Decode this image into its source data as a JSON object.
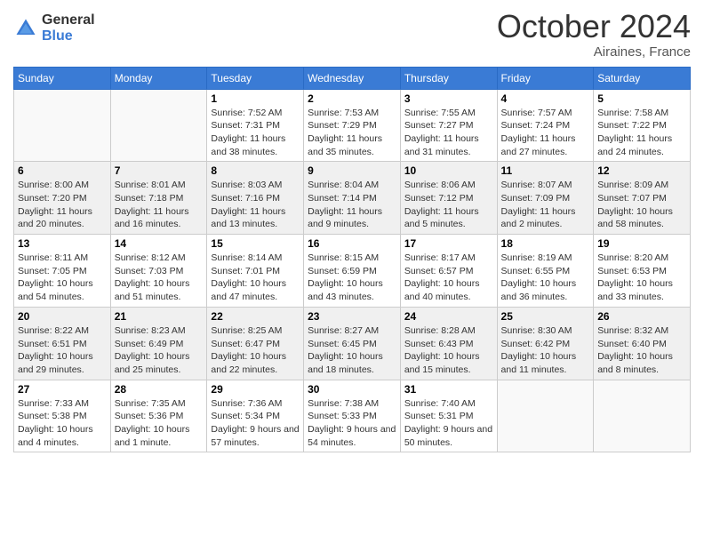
{
  "header": {
    "logo_general": "General",
    "logo_blue": "Blue",
    "month_title": "October 2024",
    "location": "Airaines, France"
  },
  "weekdays": [
    "Sunday",
    "Monday",
    "Tuesday",
    "Wednesday",
    "Thursday",
    "Friday",
    "Saturday"
  ],
  "weeks": [
    [
      {
        "day": "",
        "info": ""
      },
      {
        "day": "",
        "info": ""
      },
      {
        "day": "1",
        "sunrise": "Sunrise: 7:52 AM",
        "sunset": "Sunset: 7:31 PM",
        "daylight": "Daylight: 11 hours and 38 minutes."
      },
      {
        "day": "2",
        "sunrise": "Sunrise: 7:53 AM",
        "sunset": "Sunset: 7:29 PM",
        "daylight": "Daylight: 11 hours and 35 minutes."
      },
      {
        "day": "3",
        "sunrise": "Sunrise: 7:55 AM",
        "sunset": "Sunset: 7:27 PM",
        "daylight": "Daylight: 11 hours and 31 minutes."
      },
      {
        "day": "4",
        "sunrise": "Sunrise: 7:57 AM",
        "sunset": "Sunset: 7:24 PM",
        "daylight": "Daylight: 11 hours and 27 minutes."
      },
      {
        "day": "5",
        "sunrise": "Sunrise: 7:58 AM",
        "sunset": "Sunset: 7:22 PM",
        "daylight": "Daylight: 11 hours and 24 minutes."
      }
    ],
    [
      {
        "day": "6",
        "sunrise": "Sunrise: 8:00 AM",
        "sunset": "Sunset: 7:20 PM",
        "daylight": "Daylight: 11 hours and 20 minutes."
      },
      {
        "day": "7",
        "sunrise": "Sunrise: 8:01 AM",
        "sunset": "Sunset: 7:18 PM",
        "daylight": "Daylight: 11 hours and 16 minutes."
      },
      {
        "day": "8",
        "sunrise": "Sunrise: 8:03 AM",
        "sunset": "Sunset: 7:16 PM",
        "daylight": "Daylight: 11 hours and 13 minutes."
      },
      {
        "day": "9",
        "sunrise": "Sunrise: 8:04 AM",
        "sunset": "Sunset: 7:14 PM",
        "daylight": "Daylight: 11 hours and 9 minutes."
      },
      {
        "day": "10",
        "sunrise": "Sunrise: 8:06 AM",
        "sunset": "Sunset: 7:12 PM",
        "daylight": "Daylight: 11 hours and 5 minutes."
      },
      {
        "day": "11",
        "sunrise": "Sunrise: 8:07 AM",
        "sunset": "Sunset: 7:09 PM",
        "daylight": "Daylight: 11 hours and 2 minutes."
      },
      {
        "day": "12",
        "sunrise": "Sunrise: 8:09 AM",
        "sunset": "Sunset: 7:07 PM",
        "daylight": "Daylight: 10 hours and 58 minutes."
      }
    ],
    [
      {
        "day": "13",
        "sunrise": "Sunrise: 8:11 AM",
        "sunset": "Sunset: 7:05 PM",
        "daylight": "Daylight: 10 hours and 54 minutes."
      },
      {
        "day": "14",
        "sunrise": "Sunrise: 8:12 AM",
        "sunset": "Sunset: 7:03 PM",
        "daylight": "Daylight: 10 hours and 51 minutes."
      },
      {
        "day": "15",
        "sunrise": "Sunrise: 8:14 AM",
        "sunset": "Sunset: 7:01 PM",
        "daylight": "Daylight: 10 hours and 47 minutes."
      },
      {
        "day": "16",
        "sunrise": "Sunrise: 8:15 AM",
        "sunset": "Sunset: 6:59 PM",
        "daylight": "Daylight: 10 hours and 43 minutes."
      },
      {
        "day": "17",
        "sunrise": "Sunrise: 8:17 AM",
        "sunset": "Sunset: 6:57 PM",
        "daylight": "Daylight: 10 hours and 40 minutes."
      },
      {
        "day": "18",
        "sunrise": "Sunrise: 8:19 AM",
        "sunset": "Sunset: 6:55 PM",
        "daylight": "Daylight: 10 hours and 36 minutes."
      },
      {
        "day": "19",
        "sunrise": "Sunrise: 8:20 AM",
        "sunset": "Sunset: 6:53 PM",
        "daylight": "Daylight: 10 hours and 33 minutes."
      }
    ],
    [
      {
        "day": "20",
        "sunrise": "Sunrise: 8:22 AM",
        "sunset": "Sunset: 6:51 PM",
        "daylight": "Daylight: 10 hours and 29 minutes."
      },
      {
        "day": "21",
        "sunrise": "Sunrise: 8:23 AM",
        "sunset": "Sunset: 6:49 PM",
        "daylight": "Daylight: 10 hours and 25 minutes."
      },
      {
        "day": "22",
        "sunrise": "Sunrise: 8:25 AM",
        "sunset": "Sunset: 6:47 PM",
        "daylight": "Daylight: 10 hours and 22 minutes."
      },
      {
        "day": "23",
        "sunrise": "Sunrise: 8:27 AM",
        "sunset": "Sunset: 6:45 PM",
        "daylight": "Daylight: 10 hours and 18 minutes."
      },
      {
        "day": "24",
        "sunrise": "Sunrise: 8:28 AM",
        "sunset": "Sunset: 6:43 PM",
        "daylight": "Daylight: 10 hours and 15 minutes."
      },
      {
        "day": "25",
        "sunrise": "Sunrise: 8:30 AM",
        "sunset": "Sunset: 6:42 PM",
        "daylight": "Daylight: 10 hours and 11 minutes."
      },
      {
        "day": "26",
        "sunrise": "Sunrise: 8:32 AM",
        "sunset": "Sunset: 6:40 PM",
        "daylight": "Daylight: 10 hours and 8 minutes."
      }
    ],
    [
      {
        "day": "27",
        "sunrise": "Sunrise: 7:33 AM",
        "sunset": "Sunset: 5:38 PM",
        "daylight": "Daylight: 10 hours and 4 minutes."
      },
      {
        "day": "28",
        "sunrise": "Sunrise: 7:35 AM",
        "sunset": "Sunset: 5:36 PM",
        "daylight": "Daylight: 10 hours and 1 minute."
      },
      {
        "day": "29",
        "sunrise": "Sunrise: 7:36 AM",
        "sunset": "Sunset: 5:34 PM",
        "daylight": "Daylight: 9 hours and 57 minutes."
      },
      {
        "day": "30",
        "sunrise": "Sunrise: 7:38 AM",
        "sunset": "Sunset: 5:33 PM",
        "daylight": "Daylight: 9 hours and 54 minutes."
      },
      {
        "day": "31",
        "sunrise": "Sunrise: 7:40 AM",
        "sunset": "Sunset: 5:31 PM",
        "daylight": "Daylight: 9 hours and 50 minutes."
      },
      {
        "day": "",
        "info": ""
      },
      {
        "day": "",
        "info": ""
      }
    ]
  ]
}
